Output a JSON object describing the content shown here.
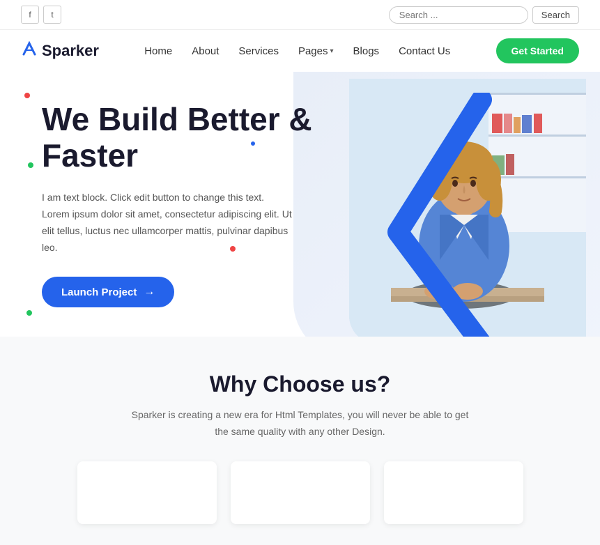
{
  "topbar": {
    "social": [
      {
        "icon": "f",
        "name": "facebook"
      },
      {
        "icon": "t",
        "name": "twitter"
      }
    ],
    "search_placeholder": "Search ...",
    "search_button": "Search"
  },
  "navbar": {
    "logo_text": "Sparker",
    "links": [
      {
        "label": "Home",
        "has_dropdown": false
      },
      {
        "label": "About",
        "has_dropdown": false
      },
      {
        "label": "Services",
        "has_dropdown": false
      },
      {
        "label": "Pages",
        "has_dropdown": true
      },
      {
        "label": "Blogs",
        "has_dropdown": false
      },
      {
        "label": "Contact Us",
        "has_dropdown": false
      }
    ],
    "cta_label": "Get Started"
  },
  "hero": {
    "title_line1": "We Build Better &",
    "title_line2": "Faster",
    "description": "I am text block. Click edit button to change this text. Lorem ipsum dolor sit amet, consectetur adipiscing elit. Ut elit tellus, luctus nec ullamcorper mattis, pulvinar dapibus leo.",
    "button_label": "Launch Project",
    "button_arrow": "→"
  },
  "why_section": {
    "title": "Why Choose us?",
    "description": "Sparker is creating a new era for Html Templates, you will never be able to get the same quality with any other Design."
  },
  "decorative": {
    "dot1_style": "top: 110px; left: 35px;",
    "dot2_style": "top: 220px; left: 40px;",
    "dot3_style": "top: 320px; left: 330px;",
    "dot4_style": "top: 180px; left: 360px;",
    "dot5_style": "top: 415px; left: 38px;"
  }
}
